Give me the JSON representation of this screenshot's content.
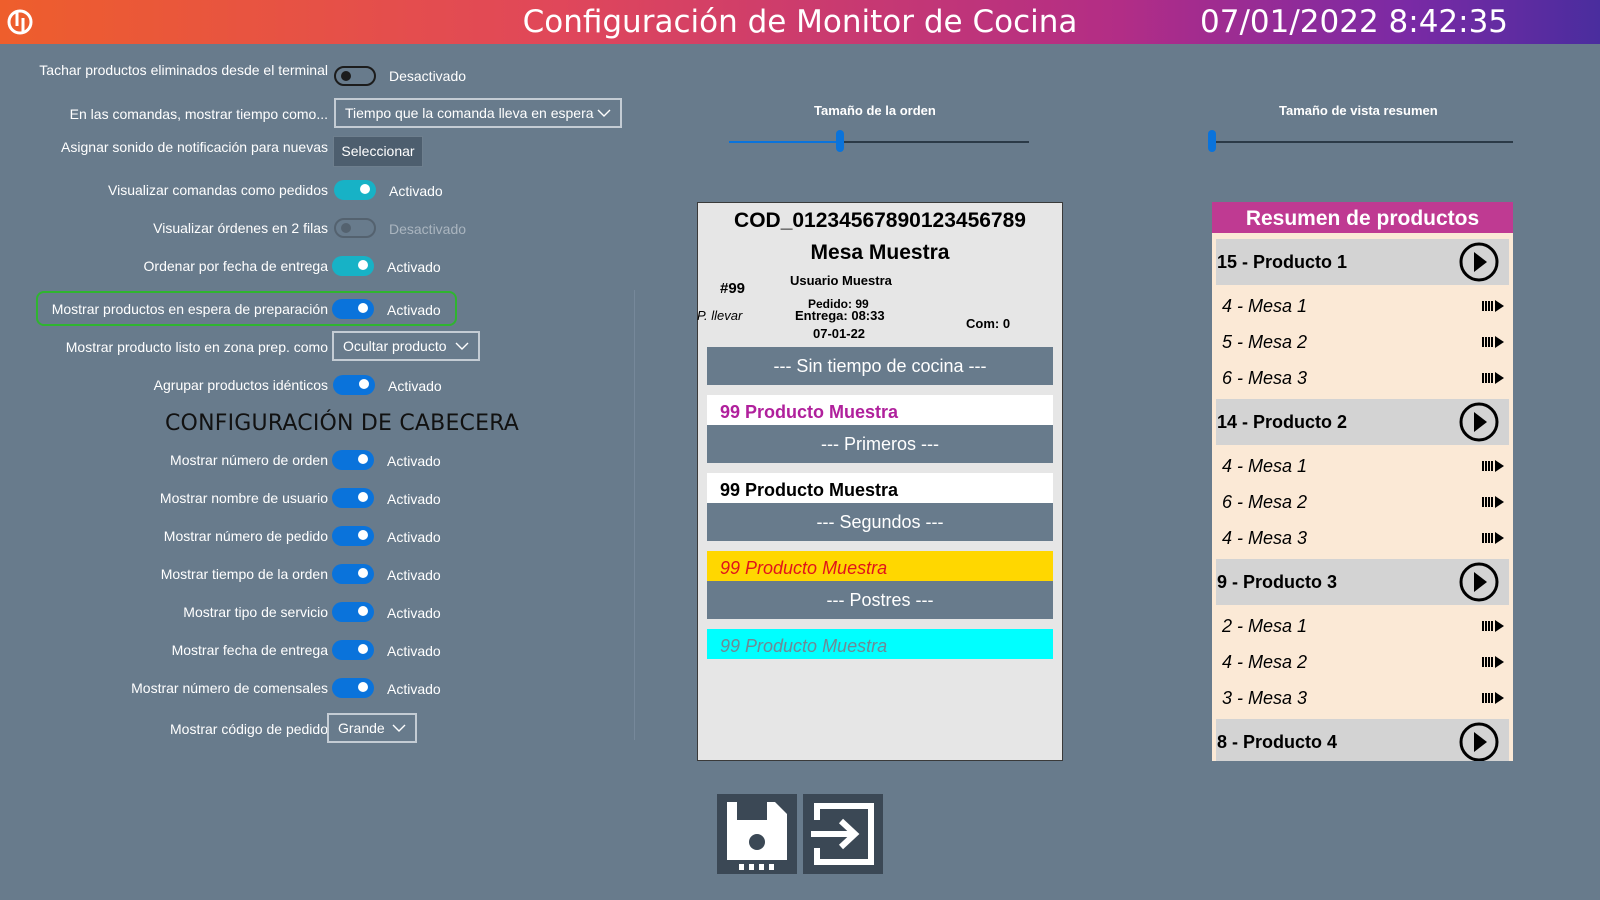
{
  "header": {
    "title": "Configuración de Monitor de Cocina",
    "datetime": "07/01/2022 8:42:35"
  },
  "settings": {
    "strike_removed": {
      "label": "Tachar productos eliminados desde el terminal principal",
      "state": "Desactivado"
    },
    "show_time_as": {
      "label": "En las comandas, mostrar tiempo como...",
      "value": "Tiempo que la comanda lleva en espera"
    },
    "notify_sound": {
      "label": "Asignar sonido de notificación para nuevas comandas",
      "button": "Seleccionar"
    },
    "orders_as_requests": {
      "label": "Visualizar comandas como pedidos",
      "state": "Activado"
    },
    "two_rows": {
      "label": "Visualizar órdenes en 2 filas",
      "state": "Desactivado"
    },
    "sort_delivery": {
      "label": "Ordenar por fecha de entrega",
      "state": "Activado"
    },
    "show_waiting": {
      "label": "Mostrar productos en espera de preparación",
      "state": "Activado"
    },
    "ready_product_as": {
      "label": "Mostrar producto listo en zona prep. como",
      "value": "Ocultar producto"
    },
    "group_identical": {
      "label": "Agrupar productos idénticos",
      "state": "Activado"
    }
  },
  "header_config": {
    "title": "CONFIGURACIÓN DE CABECERA",
    "order_number": {
      "label": "Mostrar número de orden",
      "state": "Activado"
    },
    "user_name": {
      "label": "Mostrar nombre de usuario",
      "state": "Activado"
    },
    "request_number": {
      "label": "Mostrar número de pedido",
      "state": "Activado"
    },
    "order_time": {
      "label": "Mostrar tiempo de la orden",
      "state": "Activado"
    },
    "service_type": {
      "label": "Mostrar tipo de servicio",
      "state": "Activado"
    },
    "delivery_date": {
      "label": "Mostrar fecha de entrega",
      "state": "Activado"
    },
    "diners": {
      "label": "Mostrar número de comensales",
      "state": "Activado"
    },
    "order_code": {
      "label": "Mostrar código de pedido",
      "value": "Grande"
    }
  },
  "sliders": {
    "order_size": {
      "label": "Tamaño de la orden",
      "value": 0.37
    },
    "summary_size": {
      "label": "Tamaño de vista resumen",
      "value": 0.0
    }
  },
  "order_preview": {
    "code": "COD_01234567890123456789",
    "table": "Mesa Muestra",
    "user": "Usuario Muestra",
    "number": "#99",
    "service": "P. llevar",
    "request": "Pedido: 99",
    "delivery": "Entrega: 08:33",
    "date": "07-01-22",
    "diners": "Com: 0",
    "courses": [
      "--- Sin tiempo de cocina ---",
      "--- Primeros ---",
      "--- Segundos ---",
      "--- Postres ---"
    ],
    "products": [
      {
        "text": "99 Producto Muestra",
        "color": "#b0209c",
        "bg": "#ffffff"
      },
      {
        "text": "99 Producto Muestra",
        "color": "#000000",
        "bg": "#ffffff"
      },
      {
        "text": "99 Producto Muestra",
        "color": "#e0141b",
        "bg": "#ffd700"
      },
      {
        "text": "99 Producto Muestra",
        "color": "#6e8a95",
        "bg": "#00ffff"
      }
    ]
  },
  "summary": {
    "title": "Resumen de productos",
    "groups": [
      {
        "label": "15 - Producto 1",
        "rows": [
          "4 - Mesa 1",
          "5 - Mesa 2",
          "6 - Mesa 3"
        ]
      },
      {
        "label": "14 - Producto 2",
        "rows": [
          "4 - Mesa 1",
          "6 - Mesa 2",
          "4 - Mesa 3"
        ]
      },
      {
        "label": "9 - Producto 3",
        "rows": [
          "2 - Mesa 1",
          "4 - Mesa 2",
          "3 - Mesa 3"
        ]
      },
      {
        "label": "8 - Producto 4",
        "rows": []
      }
    ]
  },
  "toolbar": {
    "save_icon": "floppy-disk-icon",
    "exit_icon": "exit-icon"
  },
  "colors": {
    "accent": "#0a73db",
    "teal": "#17b2c6",
    "background": "#687b8c",
    "summary_header": "#bf3a92"
  }
}
